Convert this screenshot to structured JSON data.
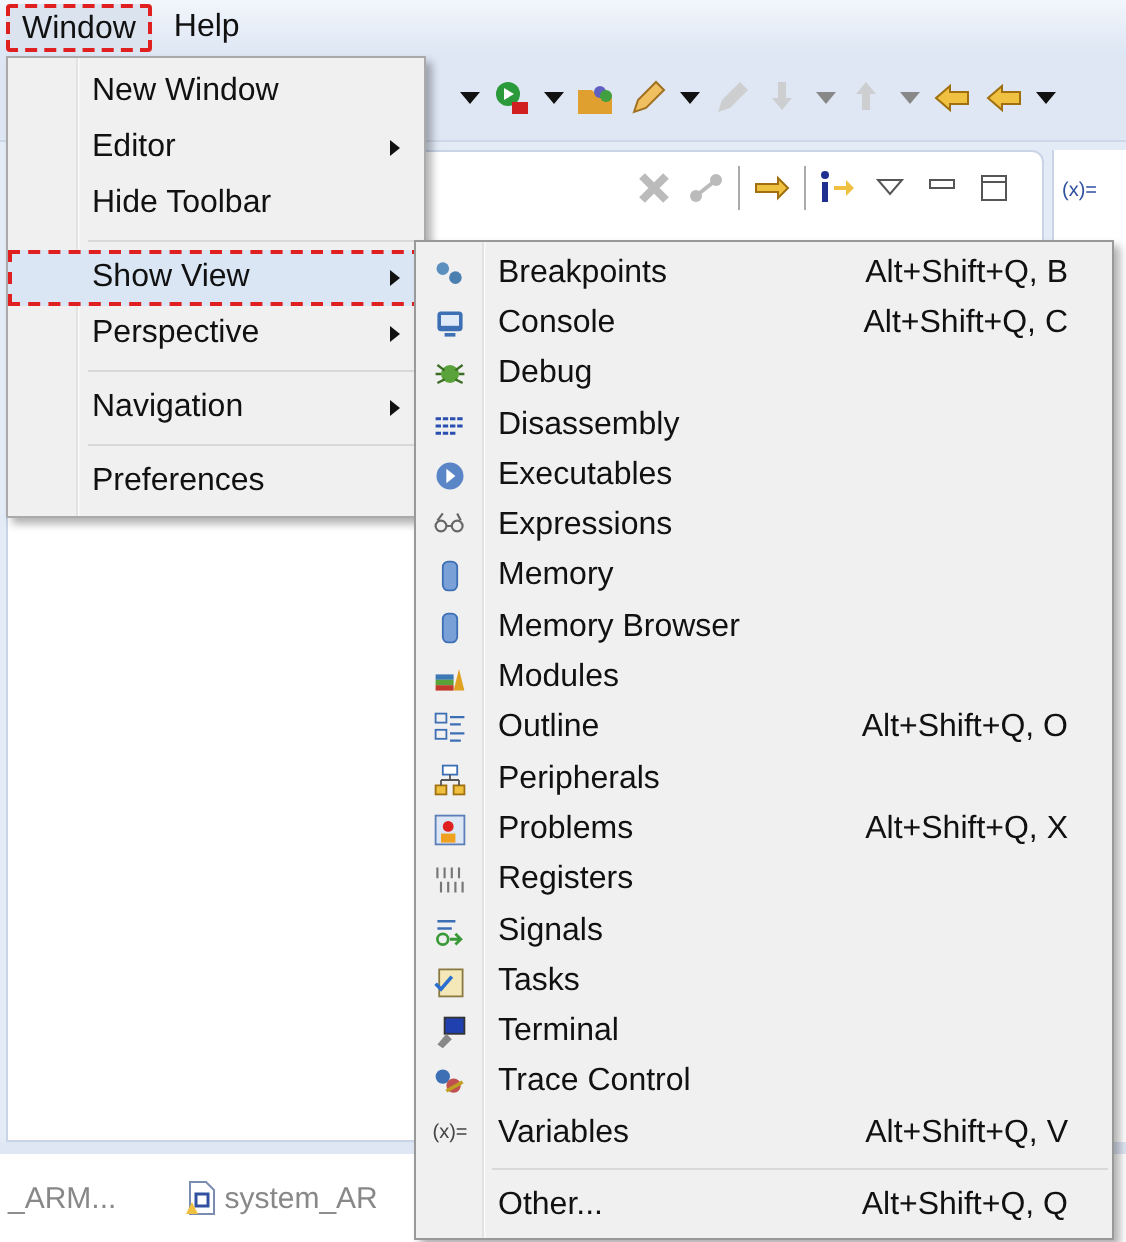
{
  "menubar": [
    {
      "label": "Window",
      "selected": true
    },
    {
      "label": "Help",
      "selected": false
    }
  ],
  "side_tab": {
    "label": "(x)="
  },
  "editor_tabs": [
    {
      "label": "_ARM...",
      "kind": "text"
    },
    {
      "label": "system_AR",
      "kind": "c-file"
    }
  ],
  "window_menu": [
    {
      "kind": "item",
      "label": "New Window",
      "submenu": false,
      "selected": false
    },
    {
      "kind": "item",
      "label": "Editor",
      "submenu": true,
      "selected": false
    },
    {
      "kind": "item",
      "label": "Hide Toolbar",
      "submenu": false,
      "selected": false
    },
    {
      "kind": "separator"
    },
    {
      "kind": "item",
      "label": "Show View",
      "submenu": true,
      "selected": true
    },
    {
      "kind": "item",
      "label": "Perspective",
      "submenu": true,
      "selected": false
    },
    {
      "kind": "separator"
    },
    {
      "kind": "item",
      "label": "Navigation",
      "submenu": true,
      "selected": false
    },
    {
      "kind": "separator"
    },
    {
      "kind": "item",
      "label": "Preferences",
      "submenu": false,
      "selected": false
    }
  ],
  "show_view_menu": [
    {
      "kind": "item",
      "label": "Breakpoints",
      "shortcut": "Alt+Shift+Q, B"
    },
    {
      "kind": "item",
      "label": "Console",
      "shortcut": "Alt+Shift+Q, C"
    },
    {
      "kind": "item",
      "label": "Debug"
    },
    {
      "kind": "item",
      "label": "Disassembly"
    },
    {
      "kind": "item",
      "label": "Executables"
    },
    {
      "kind": "item",
      "label": "Expressions"
    },
    {
      "kind": "item",
      "label": "Memory"
    },
    {
      "kind": "item",
      "label": "Memory Browser"
    },
    {
      "kind": "item",
      "label": "Modules"
    },
    {
      "kind": "item",
      "label": "Outline",
      "shortcut": "Alt+Shift+Q, O"
    },
    {
      "kind": "item",
      "label": "Peripherals"
    },
    {
      "kind": "item",
      "label": "Problems",
      "shortcut": "Alt+Shift+Q, X"
    },
    {
      "kind": "item",
      "label": "Registers"
    },
    {
      "kind": "item",
      "label": "Signals"
    },
    {
      "kind": "item",
      "label": "Tasks"
    },
    {
      "kind": "item",
      "label": "Terminal"
    },
    {
      "kind": "item",
      "label": "Trace Control"
    },
    {
      "kind": "text-icon",
      "label": "Variables",
      "shortcut": "Alt+Shift+Q, V",
      "icon_text": "(x)="
    },
    {
      "kind": "separator"
    },
    {
      "kind": "item",
      "label": "Other...",
      "shortcut": "Alt+Shift+Q, Q"
    }
  ]
}
